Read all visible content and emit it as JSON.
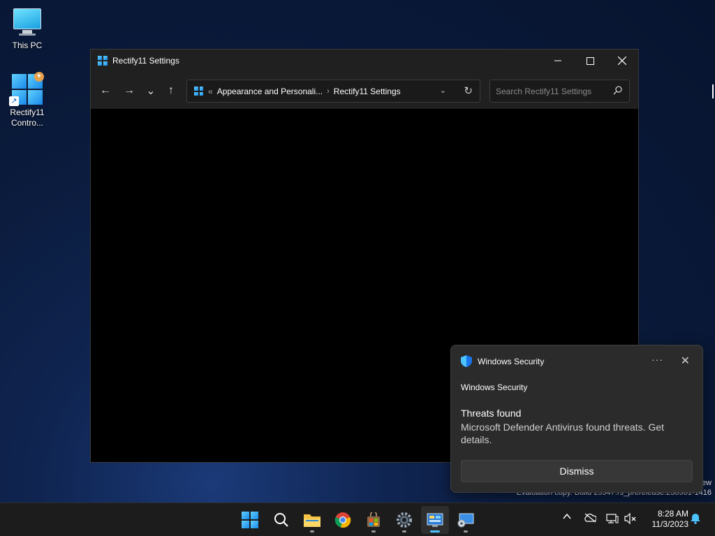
{
  "desktop": {
    "icons": [
      {
        "label": "This PC"
      },
      {
        "label": "Rectify11 Contro..."
      }
    ]
  },
  "window": {
    "title": "Rectify11 Settings",
    "controls": {
      "minimize": "—",
      "maximize": "☐",
      "close": "✕"
    },
    "nav": {
      "back": "←",
      "forward": "→",
      "recent": "⌄",
      "up": "↑"
    },
    "address": {
      "overflow": "«",
      "crumb1": "Appearance and Personali...",
      "separator": "›",
      "crumb2": "Rectify11 Settings",
      "dropdown": "⌄",
      "refresh": "↻"
    },
    "search": {
      "placeholder": "Search Rectify11 Settings"
    }
  },
  "watermark": {
    "line1": "ew",
    "line2": "Evaluation copy. Build 25947.rs_prerelease.230901-1416"
  },
  "toast": {
    "app": "Windows Security",
    "more": "···",
    "close": "✕",
    "sender": "Windows Security",
    "title": "Threats found",
    "body": "Microsoft Defender Antivirus found threats. Get details.",
    "dismiss": "Dismiss"
  },
  "taskbar": {
    "items": [
      "start-icon",
      "search-icon",
      "file-explorer-icon",
      "chrome-icon",
      "store-icon",
      "settings-icon",
      "control-panel-icon",
      "network-app-icon"
    ],
    "tray": {
      "chevron": "^"
    },
    "clock": {
      "time": "8:28 AM",
      "date": "11/3/2023"
    }
  },
  "colors": {
    "accent": "#4cc2ff",
    "toast_bg": "#2b2b2b",
    "taskbar_bg": "#1c1c1c",
    "titlebar_bg": "#202020"
  }
}
